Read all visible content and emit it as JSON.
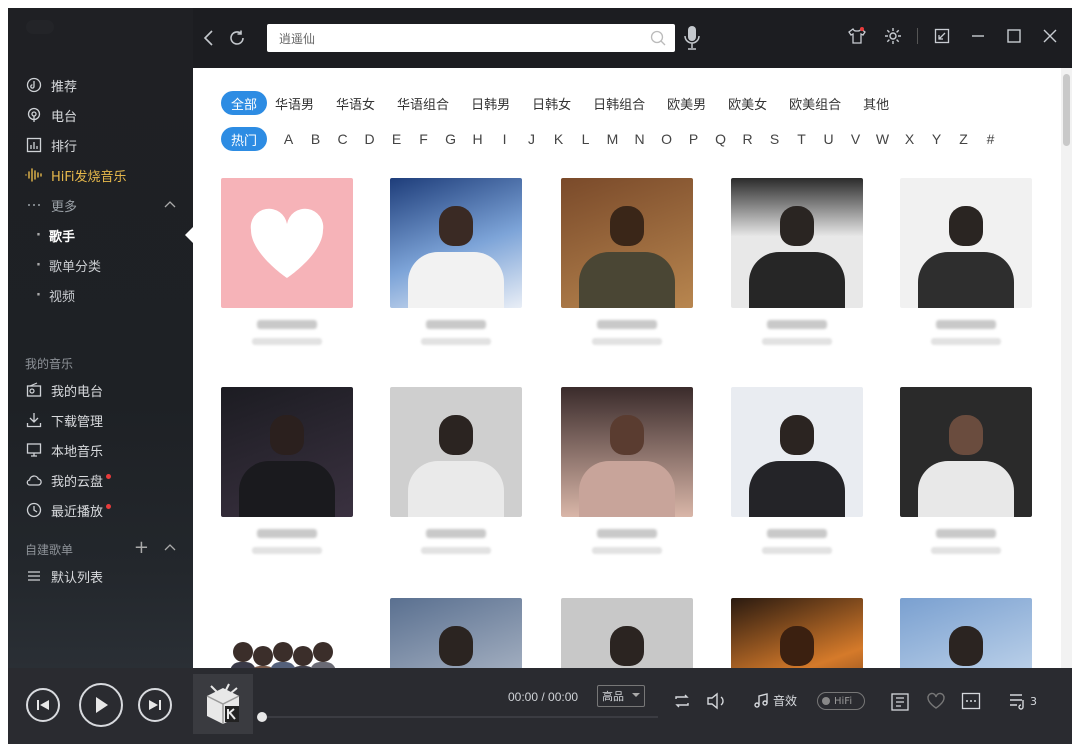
{
  "search": {
    "value": "逍遥仙"
  },
  "sidebar": {
    "nav": [
      {
        "label": "推荐",
        "icon": "recommend-icon"
      },
      {
        "label": "电台",
        "icon": "radio-icon"
      },
      {
        "label": "排行",
        "icon": "chart-icon"
      },
      {
        "label": "HiFi发烧音乐",
        "icon": "hifi-wave-icon"
      },
      {
        "label": "更多",
        "icon": "more-dots-icon"
      }
    ],
    "sub": [
      "歌手",
      "歌单分类",
      "视频"
    ],
    "my_music_title": "我的音乐",
    "my_music": [
      {
        "label": "我的电台",
        "icon": "my-radio-icon",
        "dot": false
      },
      {
        "label": "下载管理",
        "icon": "download-icon",
        "dot": false
      },
      {
        "label": "本地音乐",
        "icon": "monitor-icon",
        "dot": false
      },
      {
        "label": "我的云盘",
        "icon": "cloud-icon",
        "dot": true
      },
      {
        "label": "最近播放",
        "icon": "clock-icon",
        "dot": true
      }
    ],
    "playlist_title": "自建歌单",
    "default_list": "默认列表"
  },
  "filters": {
    "categories": [
      "全部",
      "华语男",
      "华语女",
      "华语组合",
      "日韩男",
      "日韩女",
      "日韩组合",
      "欧美男",
      "欧美女",
      "欧美组合",
      "其他"
    ],
    "letters": [
      "热门",
      "A",
      "B",
      "C",
      "D",
      "E",
      "F",
      "G",
      "H",
      "I",
      "J",
      "K",
      "L",
      "M",
      "N",
      "O",
      "P",
      "Q",
      "R",
      "S",
      "T",
      "U",
      "V",
      "W",
      "X",
      "Y",
      "Z",
      "#"
    ]
  },
  "player": {
    "time": "00:00 / 00:00",
    "quality": "高品",
    "effect": "音效",
    "hifi": "HiFi",
    "queue_count": "3"
  },
  "colors": {
    "accent": "#2d8ce3",
    "hifi_gold": "#e6b84b",
    "sidebar_bg": "#1f2024",
    "player_bg": "#2a2b30",
    "badge_red": "#e83b3b"
  }
}
